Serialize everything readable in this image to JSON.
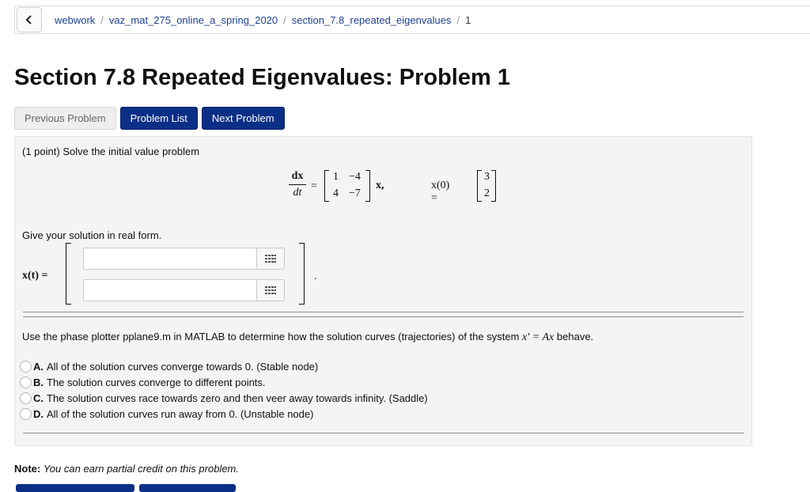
{
  "breadcrumb": {
    "items": [
      "webwork",
      "vaz_mat_275_online_a_spring_2020",
      "section_7.8_repeated_eigenvalues",
      "1"
    ],
    "separator": "/"
  },
  "page_title": "Section 7.8 Repeated Eigenvalues: Problem 1",
  "nav": {
    "previous": "Previous Problem",
    "list": "Problem List",
    "next": "Next Problem"
  },
  "problem": {
    "points": "(1 point)",
    "prompt": "Solve the initial value problem",
    "equation": {
      "dx": "dx",
      "dt": "dt",
      "equals": "=",
      "matrix": [
        [
          "1",
          "−4"
        ],
        [
          "4",
          "−7"
        ]
      ],
      "x_vec": "x,",
      "x0_label": "x(0) =",
      "x0": [
        "3",
        "2"
      ]
    },
    "real_form": "Give your solution in real form.",
    "answer_label": "x(t) =",
    "answer_values": [
      "",
      ""
    ],
    "period": ".",
    "phase_text": "Use the phase plotter pplane9.m in MATLAB to determine how the solution curves (trajectories) of the system",
    "phase_eq": "x′ = Ax",
    "phase_tail": "behave.",
    "choices": [
      {
        "letter": "A.",
        "text": "All of the solution curves converge towards 0. (Stable node)"
      },
      {
        "letter": "B.",
        "text": "The solution curves converge to different points."
      },
      {
        "letter": "C.",
        "text": "The solution curves race towards zero and then veer away towards infinity. (Saddle)"
      },
      {
        "letter": "D.",
        "text": "All of the solution curves run away from 0. (Unstable node)"
      }
    ]
  },
  "note": {
    "label": "Note:",
    "text": "You can earn partial credit on this problem."
  },
  "colors": {
    "primary_button": "#0b2f86",
    "link": "#1d3f8f",
    "panel": "#f4f4f4"
  },
  "icons": {
    "back": "chevron-left-icon",
    "matrix_palette": "grid-icon"
  }
}
